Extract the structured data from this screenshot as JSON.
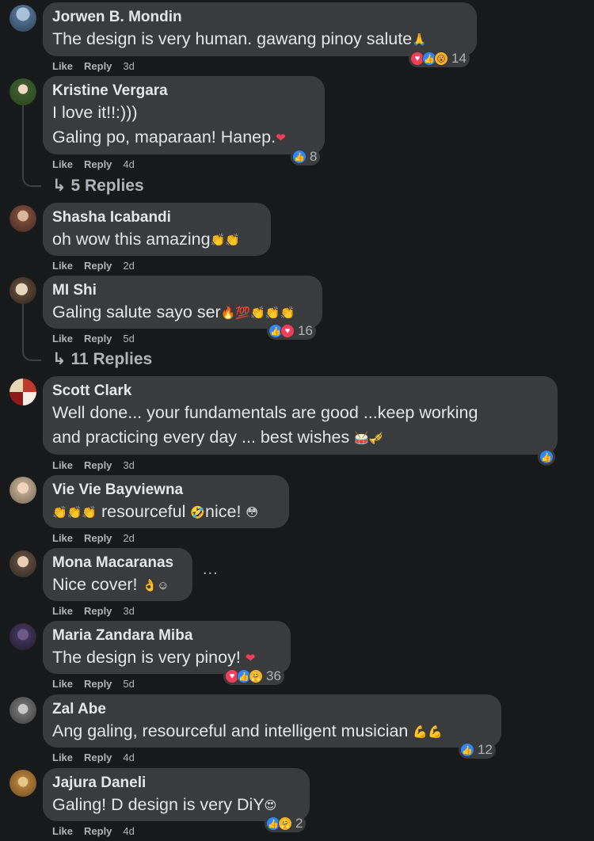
{
  "comments": [
    {
      "author": "Jorwen B. Mondin",
      "text": "The design is very human. gawang pinoy salute",
      "emoji": "🙏",
      "like": "Like",
      "reply": "Reply",
      "time": "3d",
      "reaction_count": "14"
    },
    {
      "author": "Kristine Vergara",
      "text": "I love it!!:)))",
      "text2": "Galing po, maparaan! Hanep.",
      "emoji": "❤",
      "like": "Like",
      "reply": "Reply",
      "time": "4d",
      "reaction_count": "8",
      "replies": "5 Replies"
    },
    {
      "author": "Shasha Icabandi",
      "text": "oh wow this amazing",
      "emoji": "👏👏",
      "like": "Like",
      "reply": "Reply",
      "time": "2d"
    },
    {
      "author": "MI Shi",
      "text": "Galing salute sayo ser",
      "emoji": "🔥💯👏👏👏",
      "like": "Like",
      "reply": "Reply",
      "time": "5d",
      "reaction_count": "16",
      "replies": "11 Replies"
    },
    {
      "author": "Scott Clark",
      "text": "Well done... your fundamentals are good ...keep working",
      "text2": "and practicing every day ... best wishes",
      "emoji": "🥁🎺",
      "like": "Like",
      "reply": "Reply",
      "time": "3d"
    },
    {
      "author": "Vie Vie Bayviewna",
      "emoji_pre": "👏👏👏",
      "text": " resourceful ",
      "emoji": "🤣",
      "text2": "nice! ",
      "emoji2": "😳",
      "like": "Like",
      "reply": "Reply",
      "time": "2d"
    },
    {
      "author": "Mona Macaranas",
      "text": "Nice cover! ",
      "emoji": "👌☺",
      "like": "Like",
      "reply": "Reply",
      "time": "3d"
    },
    {
      "author": "Maria Zandara Miba",
      "text": "The design is very pinoy! ",
      "emoji": "❤",
      "like": "Like",
      "reply": "Reply",
      "time": "5d",
      "reaction_count": "36"
    },
    {
      "author": "Zal Abe",
      "text": "Ang galing, resourceful and intelligent musician ",
      "emoji": "💪💪",
      "like": "Like",
      "reply": "Reply",
      "time": "4d",
      "reaction_count": "12"
    },
    {
      "author": "Jajura Daneli",
      "text": "Galing! D design is very DiY",
      "emoji": "😍",
      "like": "Like",
      "reply": "Reply",
      "time": "4d",
      "reaction_count": "2"
    }
  ],
  "more_options": "...",
  "colors": {
    "background": "#18191a",
    "bubble": "#3a3b3c",
    "like": "#2d88ff",
    "love": "#f33e58"
  }
}
